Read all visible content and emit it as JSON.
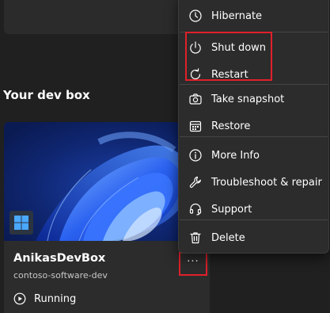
{
  "section": {
    "title": "Your dev box"
  },
  "devbox": {
    "name": "AnikasDevBox",
    "project": "contoso-software-dev",
    "status": "Running",
    "more_button_label": "···"
  },
  "menu": {
    "items": [
      {
        "label": "Hibernate",
        "icon": "hibernate-icon"
      },
      {
        "label": "Shut down",
        "icon": "power-icon"
      },
      {
        "label": "Restart",
        "icon": "restart-icon"
      },
      {
        "label": "Take snapshot",
        "icon": "camera-icon"
      },
      {
        "label": "Restore",
        "icon": "calendar-icon"
      },
      {
        "label": "More Info",
        "icon": "info-icon"
      },
      {
        "label": "Troubleshoot & repair",
        "icon": "wrench-icon"
      },
      {
        "label": "Support",
        "icon": "headset-icon"
      },
      {
        "label": "Delete",
        "icon": "trash-icon"
      }
    ]
  },
  "colors": {
    "background": "#202020",
    "card": "#2c2c2c",
    "highlight": "#e0202a",
    "text": "#ffffff",
    "muted_text": "#c8c8c8",
    "windows_bloom": "#1f4fd8"
  }
}
